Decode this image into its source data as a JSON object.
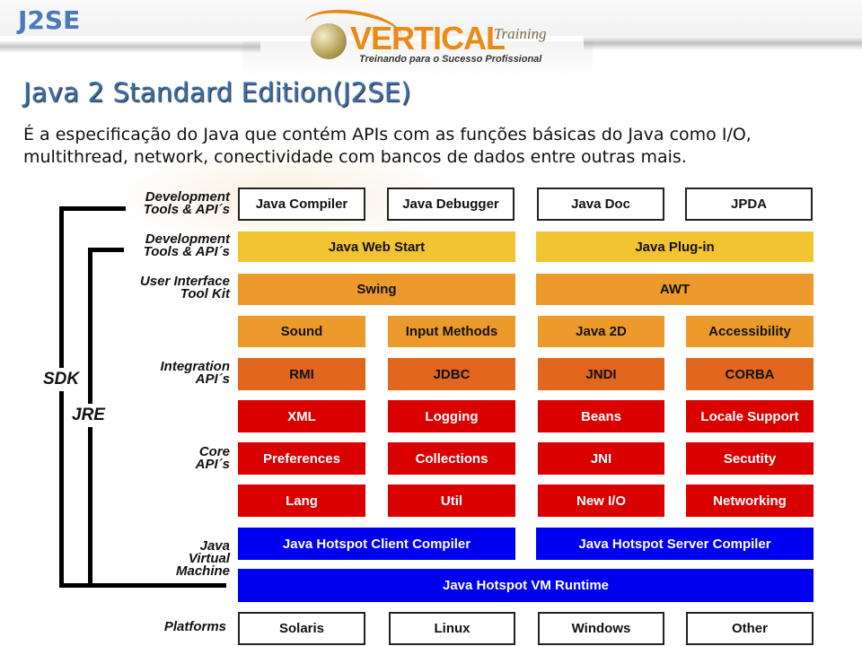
{
  "header": {
    "section": "J2SE",
    "logo_brand": "ERTICAL",
    "logo_brand_initial": "V",
    "logo_suffix": "Training",
    "logo_tagline": "Treinando para o Sucesso Profissional"
  },
  "slide": {
    "title": "Java 2 Standard Edition(J2SE)",
    "description": "É a especificação do Java que contém APIs com as funções básicas do Java como I/O, multithread, network, conectividade com bancos de dados entre outras mais."
  },
  "diagram": {
    "brackets": {
      "sdk": "SDK",
      "jre": "JRE"
    },
    "side_labels": {
      "dev_tools_1": [
        "Development",
        "Tools & API´s"
      ],
      "dev_tools_2": [
        "Development",
        "Tools & API´s"
      ],
      "ui_toolkit": [
        "User Interface",
        "Tool Kit"
      ],
      "integration": [
        "Integration",
        "API´s"
      ],
      "core": [
        "Core",
        "API´s"
      ],
      "jvm": [
        "Java",
        "Virtual",
        "Machine"
      ],
      "platforms": [
        "Platforms"
      ]
    },
    "rows": {
      "dev_tools": [
        "Java Compiler",
        "Java Debugger",
        "Java Doc",
        "JPDA"
      ],
      "deployment": [
        "Java Web Start",
        "Java Plug-in"
      ],
      "ui_toolkit": [
        "Swing",
        "AWT"
      ],
      "ui_components": [
        "Sound",
        "Input Methods",
        "Java 2D",
        "Accessibility"
      ],
      "integration": [
        "RMI",
        "JDBC",
        "JNDI",
        "CORBA"
      ],
      "core_1": [
        "XML",
        "Logging",
        "Beans",
        "Locale Support"
      ],
      "core_2": [
        "Preferences",
        "Collections",
        "JNI",
        "Secutity"
      ],
      "core_3": [
        "Lang",
        "Util",
        "New I/O",
        "Networking"
      ],
      "jvm_compilers": [
        "Java Hotspot Client Compiler",
        "Java Hotspot Server Compiler"
      ],
      "jvm_runtime": [
        "Java Hotspot VM Runtime"
      ],
      "platforms": [
        "Solaris",
        "Linux",
        "Windows",
        "Other"
      ]
    },
    "colors": {
      "tools": "#ffffff",
      "deployment": "#f2c431",
      "ui": "#ec9a2c",
      "integration": "#e1661e",
      "core": "#da0000",
      "jvm": "#0000f0"
    }
  }
}
